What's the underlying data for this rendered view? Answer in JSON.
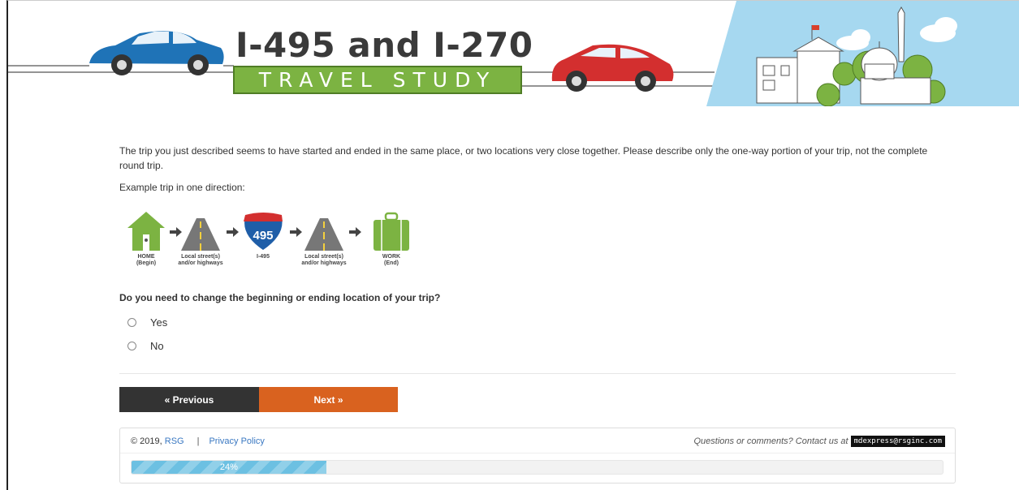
{
  "header": {
    "title": "I-495 and I-270",
    "subtitle": "TRAVEL STUDY"
  },
  "page": {
    "intro": "The trip you just described seems to have started and ended in the same place, or two locations very close together. Please describe only the one-way portion of your trip, not the complete round trip.",
    "example_label": "Example trip in one direction:"
  },
  "trip_diagram": {
    "highway_shield": "495",
    "steps": [
      {
        "icon": "home-icon",
        "label_line1": "HOME",
        "label_line2": "(Begin)"
      },
      {
        "icon": "road-icon",
        "label_line1": "Local street(s)",
        "label_line2": "and/or highways"
      },
      {
        "icon": "interstate-shield-icon",
        "label_line1": "I-495",
        "label_line2": ""
      },
      {
        "icon": "road-icon",
        "label_line1": "Local street(s)",
        "label_line2": "and/or highways"
      },
      {
        "icon": "briefcase-icon",
        "label_line1": "WORK",
        "label_line2": "(End)"
      }
    ]
  },
  "question": {
    "text": "Do you need to change the beginning or ending location of your trip?",
    "options": [
      "Yes",
      "No"
    ],
    "selected": null
  },
  "nav": {
    "previous_label": "« Previous",
    "next_label": "Next »"
  },
  "footer": {
    "copyright": "© 2019,",
    "company_link": "RSG",
    "separator": "|",
    "privacy_link": "Privacy Policy",
    "contact_text": "Questions or comments? Contact us at",
    "email": "mdexpress@rsginc.com"
  },
  "progress": {
    "percent": 24,
    "label": "24%"
  },
  "colors": {
    "accent_orange": "#d9621f",
    "dark_button": "#333333",
    "title_green": "#7cb342",
    "progress_blue": "#6cc0e2",
    "link_blue": "#3a78c2",
    "sky_blue": "#a6d8f0"
  }
}
